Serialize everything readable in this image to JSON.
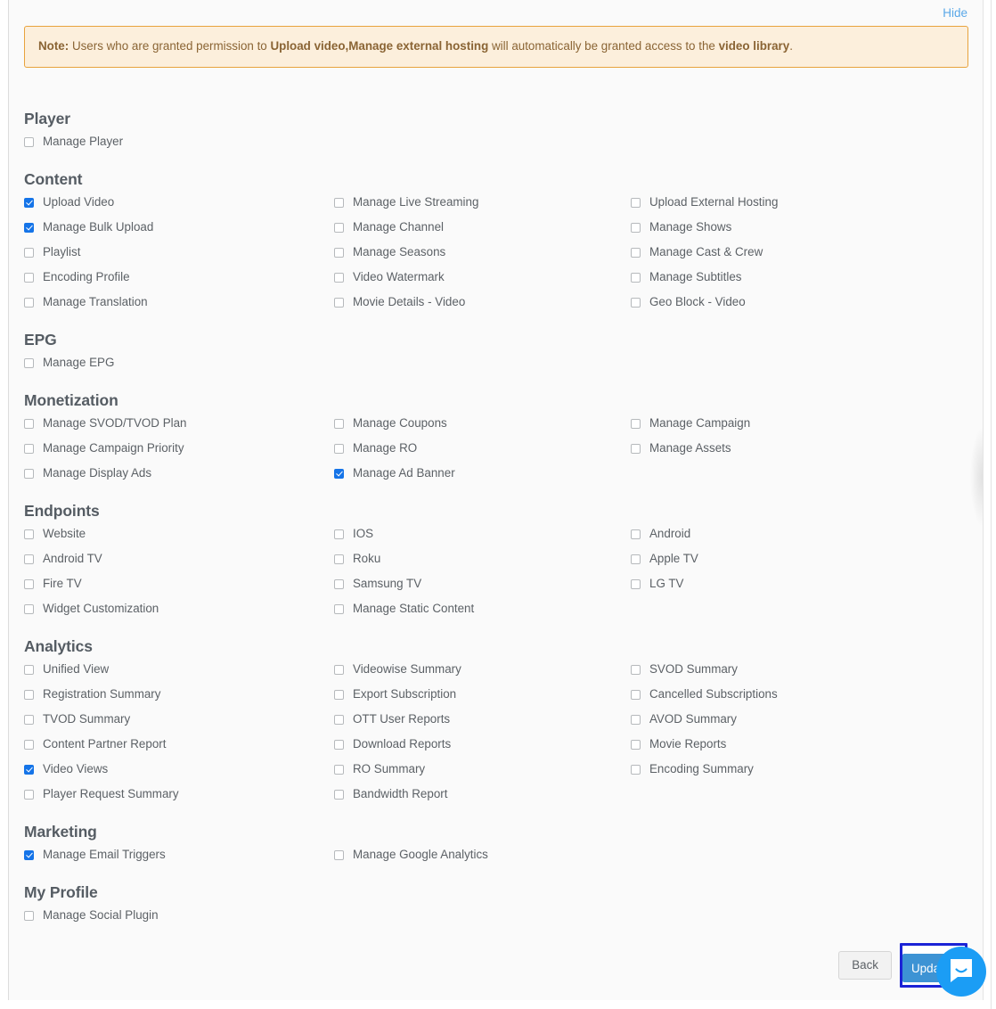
{
  "header": {
    "hide_label": "Hide"
  },
  "note": {
    "prefix": "Note:",
    "part1": " Users who are granted permission to ",
    "bold1": "Upload video,Manage external hosting",
    "part2": " will automatically be granted access to the ",
    "bold2": "video library",
    "part3": "."
  },
  "sections": [
    {
      "title": "Player",
      "options": [
        {
          "label": "Manage Player",
          "checked": false
        }
      ]
    },
    {
      "title": "Content",
      "options": [
        {
          "label": "Upload Video",
          "checked": true
        },
        {
          "label": "Manage Live Streaming",
          "checked": false
        },
        {
          "label": "Upload External Hosting",
          "checked": false
        },
        {
          "label": "Manage Bulk Upload",
          "checked": true
        },
        {
          "label": "Manage Channel",
          "checked": false
        },
        {
          "label": "Manage Shows",
          "checked": false
        },
        {
          "label": "Playlist",
          "checked": false
        },
        {
          "label": "Manage Seasons",
          "checked": false
        },
        {
          "label": "Manage Cast & Crew",
          "checked": false
        },
        {
          "label": "Encoding Profile",
          "checked": false
        },
        {
          "label": "Video Watermark",
          "checked": false
        },
        {
          "label": "Manage Subtitles",
          "checked": false
        },
        {
          "label": "Manage Translation",
          "checked": false
        },
        {
          "label": "Movie Details - Video",
          "checked": false
        },
        {
          "label": "Geo Block - Video",
          "checked": false
        }
      ]
    },
    {
      "title": "EPG",
      "options": [
        {
          "label": "Manage EPG",
          "checked": false
        }
      ]
    },
    {
      "title": "Monetization",
      "options": [
        {
          "label": "Manage SVOD/TVOD Plan",
          "checked": false
        },
        {
          "label": "Manage Coupons",
          "checked": false
        },
        {
          "label": "Manage Campaign",
          "checked": false
        },
        {
          "label": "Manage Campaign Priority",
          "checked": false
        },
        {
          "label": "Manage RO",
          "checked": false
        },
        {
          "label": "Manage Assets",
          "checked": false
        },
        {
          "label": "Manage Display Ads",
          "checked": false
        },
        {
          "label": "Manage Ad Banner",
          "checked": true
        }
      ]
    },
    {
      "title": "Endpoints",
      "options": [
        {
          "label": "Website",
          "checked": false
        },
        {
          "label": "IOS",
          "checked": false
        },
        {
          "label": "Android",
          "checked": false
        },
        {
          "label": "Android TV",
          "checked": false
        },
        {
          "label": "Roku",
          "checked": false
        },
        {
          "label": "Apple TV",
          "checked": false
        },
        {
          "label": "Fire TV",
          "checked": false
        },
        {
          "label": "Samsung TV",
          "checked": false
        },
        {
          "label": "LG TV",
          "checked": false
        },
        {
          "label": "Widget Customization",
          "checked": false
        },
        {
          "label": "Manage Static Content",
          "checked": false
        }
      ]
    },
    {
      "title": "Analytics",
      "options": [
        {
          "label": "Unified View",
          "checked": false
        },
        {
          "label": "Videowise Summary",
          "checked": false
        },
        {
          "label": "SVOD Summary",
          "checked": false
        },
        {
          "label": "Registration Summary",
          "checked": false
        },
        {
          "label": "Export Subscription",
          "checked": false
        },
        {
          "label": "Cancelled Subscriptions",
          "checked": false
        },
        {
          "label": "TVOD Summary",
          "checked": false
        },
        {
          "label": "OTT User Reports",
          "checked": false
        },
        {
          "label": "AVOD Summary",
          "checked": false
        },
        {
          "label": "Content Partner Report",
          "checked": false
        },
        {
          "label": "Download Reports",
          "checked": false
        },
        {
          "label": "Movie Reports",
          "checked": false
        },
        {
          "label": "Video Views",
          "checked": true
        },
        {
          "label": "RO Summary",
          "checked": false
        },
        {
          "label": "Encoding Summary",
          "checked": false
        },
        {
          "label": "Player Request Summary",
          "checked": false
        },
        {
          "label": "Bandwidth Report",
          "checked": false
        }
      ]
    },
    {
      "title": "Marketing",
      "options": [
        {
          "label": "Manage Email Triggers",
          "checked": true
        },
        {
          "label": "Manage Google Analytics",
          "checked": false
        }
      ]
    },
    {
      "title": "My Profile",
      "options": [
        {
          "label": "Manage Social Plugin",
          "checked": false
        }
      ]
    }
  ],
  "footer": {
    "back_label": "Back",
    "update_label": "Update"
  },
  "chat": {
    "icon": "chat-bubble-icon"
  },
  "colors": {
    "accent_blue": "#1574e8",
    "link_blue": "#5aa8e8",
    "note_bg": "#fcefdc",
    "note_border": "#e8a33d",
    "note_text": "#8a6434",
    "update_button": "#3d93d4",
    "focus_outline": "#1b23d6",
    "chat_blue": "#1b9df5"
  }
}
